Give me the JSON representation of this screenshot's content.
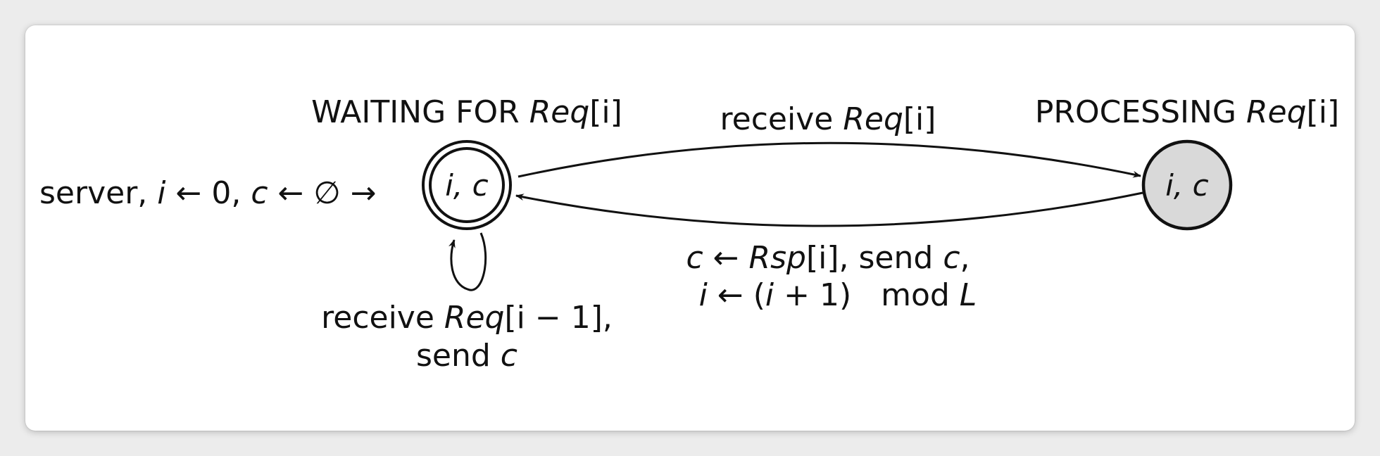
{
  "diagram": {
    "initial_label": {
      "prefix": "server, ",
      "i": "i",
      "assign_i": " ← 0, ",
      "c": "c",
      "assign_c": " ← ∅ →"
    },
    "states": {
      "waiting": {
        "title_text": "WAITING FOR ",
        "title_req": "Req",
        "title_index": "[i]",
        "content": "i, c"
      },
      "processing": {
        "title_text": "PROCESSING ",
        "title_req": "Req",
        "title_index": "[i]",
        "content": "i, c"
      }
    },
    "transitions": {
      "receive": {
        "prefix": "receive ",
        "req": "Req",
        "index": "[i]"
      },
      "respond": {
        "line1": {
          "c": "c",
          "assign": " ← ",
          "rsp": "Rsp",
          "index": "[i]",
          "tail": ", send ",
          "c2": "c",
          "comma": ","
        },
        "line2": {
          "i": "i",
          "assign": " ← (",
          "i2": "i",
          "plus": " + 1)   mod ",
          "L": "L"
        }
      },
      "self_loop": {
        "line1": {
          "prefix": "receive ",
          "req": "Req",
          "index": "[i − 1],"
        },
        "line2": {
          "prefix": "send ",
          "c": "c"
        }
      }
    },
    "colors": {
      "stroke": "#111111",
      "processing_fill": "#d9d9d9",
      "card": "#ffffff",
      "background": "#ececec"
    }
  }
}
